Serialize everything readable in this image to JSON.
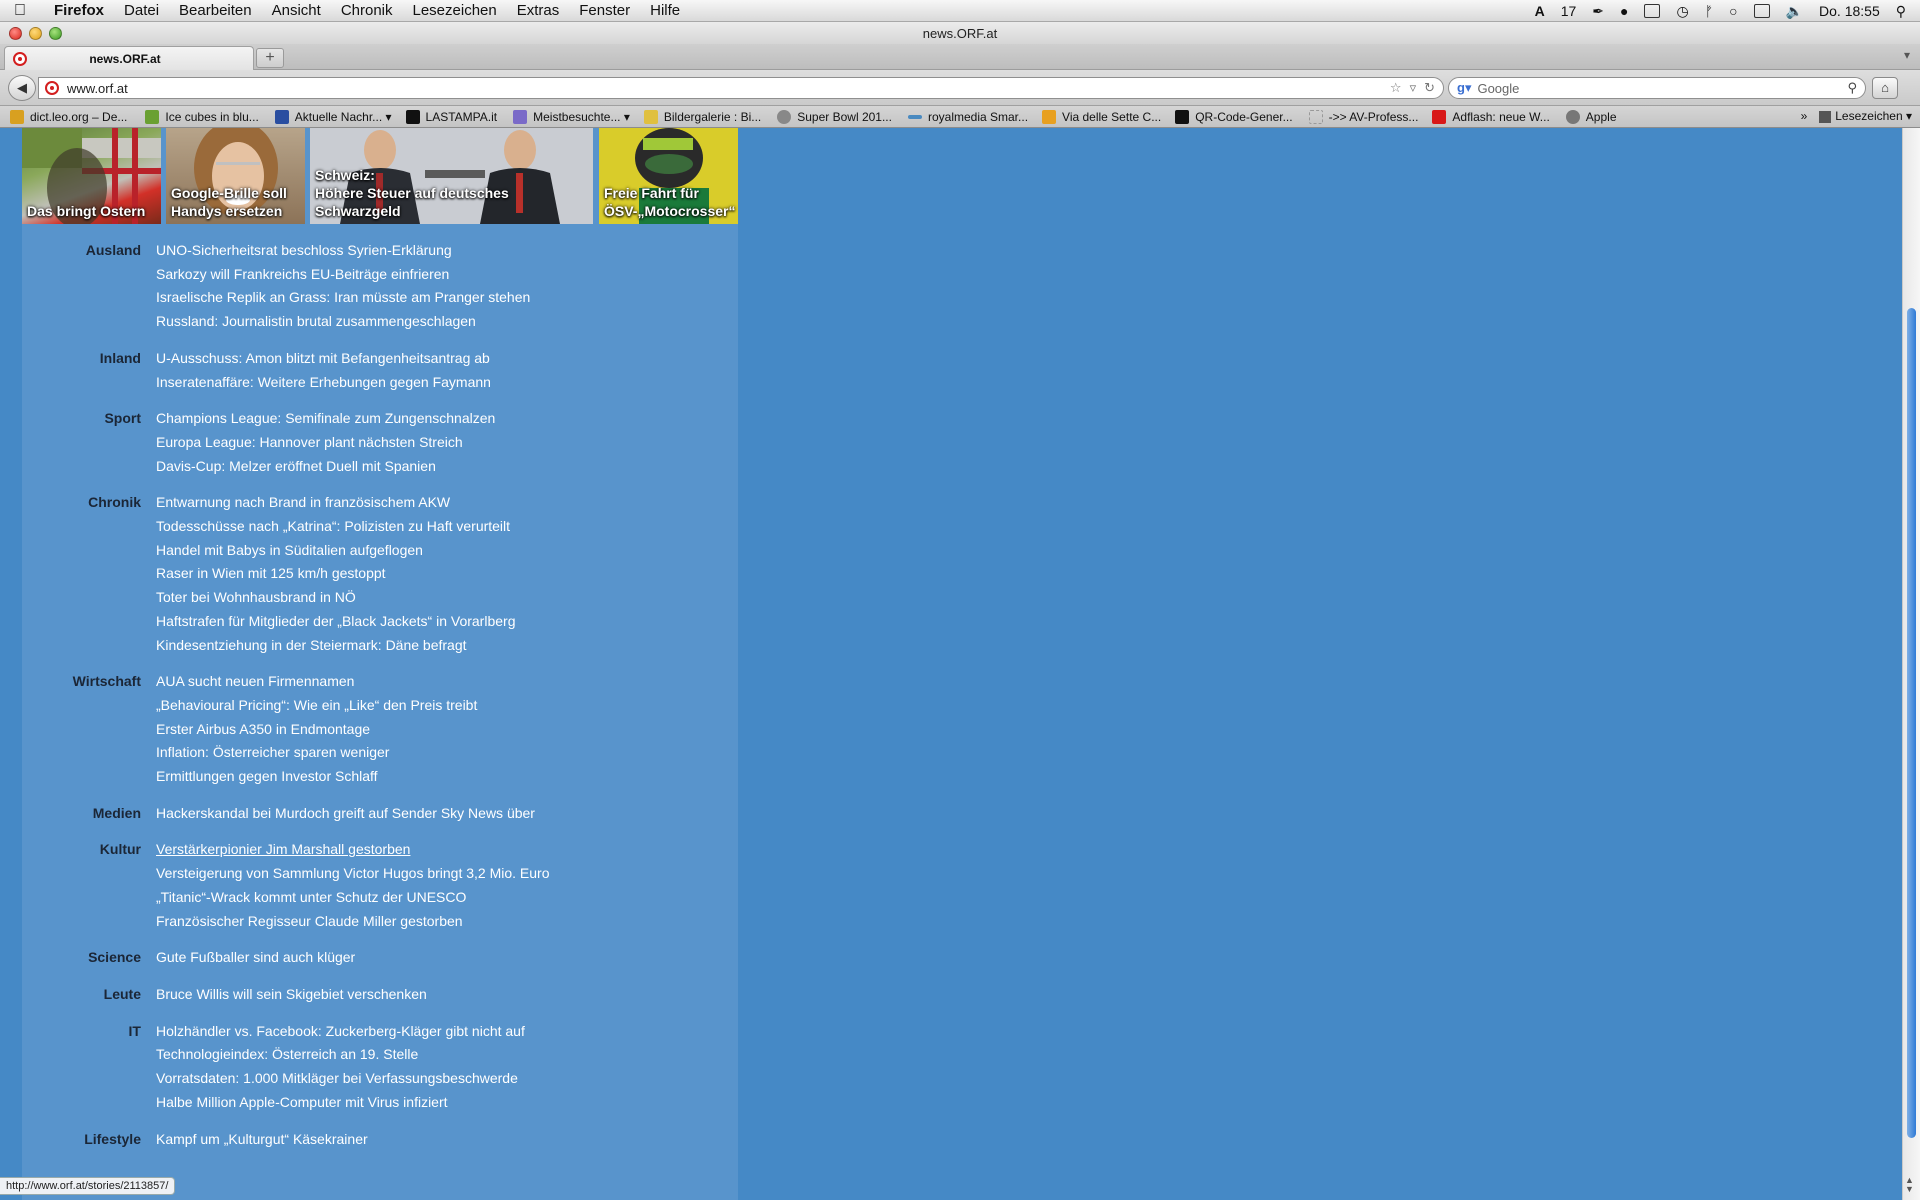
{
  "menubar": {
    "app": "Firefox",
    "menus": [
      "Datei",
      "Bearbeiten",
      "Ansicht",
      "Chronik",
      "Lesezeichen",
      "Extras",
      "Fenster",
      "Hilfe"
    ],
    "adobe_badge": "17",
    "clock": "Do. 18:55"
  },
  "window": {
    "title": "news.ORF.at"
  },
  "tab": {
    "title": "news.ORF.at",
    "new_tab": "+"
  },
  "navbar": {
    "url": "www.orf.at",
    "search_placeholder": "Google"
  },
  "bookmarks": [
    {
      "label": "dict.leo.org – De...",
      "color": "#d8a020"
    },
    {
      "label": "Ice cubes in blu...",
      "color": "#6aa032"
    },
    {
      "label": "Aktuelle Nachr...",
      "color": "#2a4ea0",
      "menu": "▾"
    },
    {
      "label": "LASTAMPA.it",
      "color": "#111111"
    },
    {
      "label": "Meistbesuchte...",
      "color": "#7a6ac8",
      "menu": "▾"
    },
    {
      "label": "Bildergalerie : Bi...",
      "color": "#e0c040"
    },
    {
      "label": "Super Bowl 201...",
      "color": "#888888"
    },
    {
      "label": "royalmedia Smar...",
      "color": "#4a8ac0"
    },
    {
      "label": "Via delle Sette C...",
      "color": "#e8a020"
    },
    {
      "label": "QR-Code-Gener...",
      "color": "#111111"
    },
    {
      "label": "->> AV-Profess...",
      "color": "#aaaaaa"
    },
    {
      "label": "Adflash: neue W...",
      "color": "#d81818"
    },
    {
      "label": "Apple",
      "color": "#777777"
    }
  ],
  "bookmarks_more": "»",
  "bookmarks_folder": "Lesezeichen",
  "thumbnails": [
    {
      "caption": "Das bringt Ostern"
    },
    {
      "caption": "Google-Brille soll Handys ersetzen"
    },
    {
      "caption": "Schweiz: Höhere Steuer auf deutsches Schwarzgeld"
    },
    {
      "caption": "Freie Fahrt für ÖSV-„Motocrosser“"
    }
  ],
  "sections": [
    {
      "label": "Ausland",
      "items": [
        "UNO-Sicherheitsrat beschloss Syrien-Erklärung",
        "Sarkozy will Frankreichs EU-Beiträge einfrieren",
        "Israelische Replik an Grass: Iran müsste am Pranger stehen",
        "Russland: Journalistin brutal zusammengeschlagen"
      ]
    },
    {
      "label": "Inland",
      "items": [
        "U-Ausschuss: Amon blitzt mit Befangenheitsantrag ab",
        "Inseratenaffäre: Weitere Erhebungen gegen Faymann"
      ]
    },
    {
      "label": "Sport",
      "items": [
        "Champions League: Semifinale zum Zungenschnalzen",
        "Europa League: Hannover plant nächsten Streich",
        "Davis-Cup: Melzer eröffnet Duell mit Spanien"
      ]
    },
    {
      "label": "Chronik",
      "items": [
        "Entwarnung nach Brand in französischem AKW",
        "Todesschüsse nach „Katrina“: Polizisten zu Haft verurteilt",
        "Handel mit Babys in Süditalien aufgeflogen",
        "Raser in Wien mit 125 km/h gestoppt",
        "Toter bei Wohnhausbrand in NÖ",
        "Haftstrafen für Mitglieder der „Black Jackets“ in Vorarlberg",
        "Kindesentziehung in der Steiermark: Däne befragt"
      ]
    },
    {
      "label": "Wirtschaft",
      "items": [
        "AUA sucht neuen Firmennamen",
        "„Behavioural Pricing“: Wie ein „Like“ den Preis treibt",
        "Erster Airbus A350 in Endmontage",
        "Inflation: Österreicher sparen weniger",
        "Ermittlungen gegen Investor Schlaff"
      ]
    },
    {
      "label": "Medien",
      "items": [
        "Hackerskandal bei Murdoch greift auf Sender Sky News über"
      ]
    },
    {
      "label": "Kultur",
      "items": [
        "Verstärkerpionier Jim Marshall gestorben",
        "Versteigerung von Sammlung Victor Hugos bringt 3,2 Mio. Euro",
        "„Titanic“-Wrack kommt unter Schutz der UNESCO",
        "Französischer Regisseur Claude Miller gestorben"
      ]
    },
    {
      "label": "Science",
      "items": [
        "Gute Fußballer sind auch klüger"
      ]
    },
    {
      "label": "Leute",
      "items": [
        "Bruce Willis will sein Skigebiet verschenken"
      ]
    },
    {
      "label": "IT",
      "items": [
        "Holzhändler vs. Facebook: Zuckerberg-Kläger gibt nicht auf",
        "Technologieindex: Österreich an 19. Stelle",
        "Vorratsdaten: 1.000 Mitkläger bei Verfassungsbeschwerde",
        "Halbe Million Apple-Computer mit Virus infiziert"
      ]
    },
    {
      "label": "Lifestyle",
      "items": [
        "Kampf um „Kulturgut“ Käsekrainer"
      ]
    }
  ],
  "status_url": "http://www.orf.at/stories/2113857/",
  "colors": {
    "page_bg": "#4589c6",
    "column_bg": "#5894cc",
    "section_label": "#1b2636",
    "link": "#ffffff"
  }
}
